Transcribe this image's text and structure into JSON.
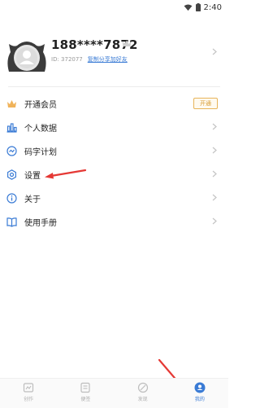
{
  "status_bar": {
    "time": "2:40"
  },
  "profile": {
    "name": "188****7872",
    "id_text": "ID: 372077",
    "share_link": "复制分享加好友"
  },
  "menu": {
    "items": [
      {
        "label": "开通会员",
        "icon": "crown-icon",
        "badge": "开通"
      },
      {
        "label": "个人数据",
        "icon": "bar-chart-icon"
      },
      {
        "label": "码字计划",
        "icon": "trend-icon"
      },
      {
        "label": "设置",
        "icon": "gear-icon"
      },
      {
        "label": "关于",
        "icon": "info-icon"
      },
      {
        "label": "使用手册",
        "icon": "book-icon"
      }
    ]
  },
  "tabbar": {
    "tabs": [
      {
        "label": "创作",
        "icon": "create-icon"
      },
      {
        "label": "便签",
        "icon": "note-icon"
      },
      {
        "label": "发现",
        "icon": "discover-icon"
      },
      {
        "label": "我的",
        "icon": "me-icon",
        "active": true
      }
    ]
  },
  "colors": {
    "accent": "#3a7bd5",
    "vip": "#e7b45a",
    "arrow": "#e53935"
  }
}
